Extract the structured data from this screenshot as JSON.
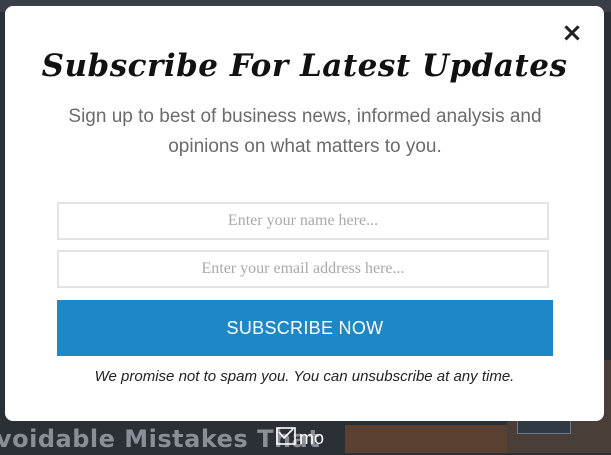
{
  "background": {
    "headline_fragment": "voidable Mistakes That"
  },
  "modal": {
    "close_icon": "×",
    "title": "Subscribe For Latest Updates",
    "subtitle": "Sign up to best of business news, informed analysis and opinions on what matters to you.",
    "name_placeholder": "Enter your name here...",
    "email_placeholder": "Enter your email address here...",
    "subscribe_label": "SUBSCRIBE NOW",
    "promise_text": "We promise not to spam you. You can unsubscribe at any time."
  },
  "brand": {
    "logo_text": "mo",
    "logo_icon": "envelope-check-icon"
  },
  "colors": {
    "accent": "#1e88c7",
    "overlay": "#2b2f36"
  }
}
